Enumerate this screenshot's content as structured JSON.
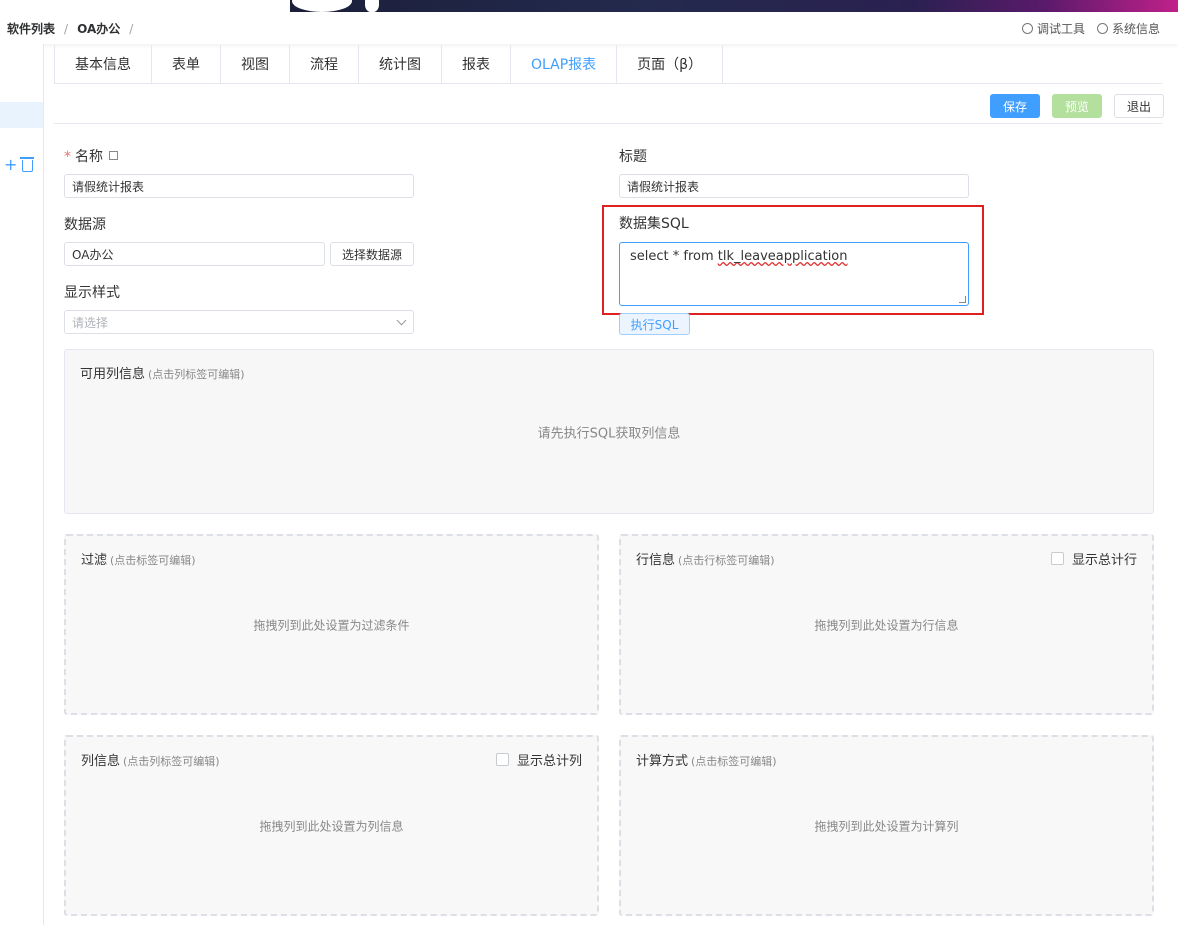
{
  "breadcrumb": [
    "软件列表",
    "OA办公"
  ],
  "breadcrumb_sep": "/",
  "toolbar": {
    "debug_tool": "调试工具",
    "system_info": "系统信息"
  },
  "tabs": [
    "基本信息",
    "表单",
    "视图",
    "流程",
    "统计图",
    "报表",
    "OLAP报表",
    "页面（β）"
  ],
  "active_tab": "OLAP报表",
  "actions": {
    "save": "保存",
    "preview": "预览",
    "exit": "退出"
  },
  "form": {
    "name_label": "名称",
    "required_mark": "*",
    "name_value": "请假统计报表",
    "title_label": "标题",
    "title_value": "请假统计报表",
    "datasource_label": "数据源",
    "datasource_value": "OA办公",
    "select_datasource_button": "选择数据源",
    "dataset_sql_label": "数据集SQL",
    "sql_prefix": "select * from ",
    "sql_table": "tlk_leaveapplication",
    "run_sql_button": "执行SQL",
    "display_style_label": "显示样式",
    "display_style_placeholder": "请选择"
  },
  "panels": {
    "columns_available": {
      "title": "可用列信息",
      "hint": "(点击列标签可编辑)",
      "empty": "请先执行SQL获取列信息"
    },
    "filter": {
      "title": "过滤",
      "hint": "(点击标签可编辑)",
      "empty": "拖拽列到此处设置为过滤条件"
    },
    "row_info": {
      "title": "行信息",
      "hint": "(点击行标签可编辑)",
      "empty": "拖拽列到此处设置为行信息",
      "checkbox": "显示总计行"
    },
    "col_info": {
      "title": "列信息",
      "hint": "(点击列标签可编辑)",
      "empty": "拖拽列到此处设置为列信息",
      "checkbox": "显示总计列"
    },
    "calc": {
      "title": "计算方式",
      "hint": "(点击标签可编辑)",
      "empty": "拖拽列到此处设置为计算列"
    }
  },
  "colors": {
    "accent": "#409eff",
    "highlight_border": "#e02020",
    "preview_disabled": "#b3e19d"
  }
}
